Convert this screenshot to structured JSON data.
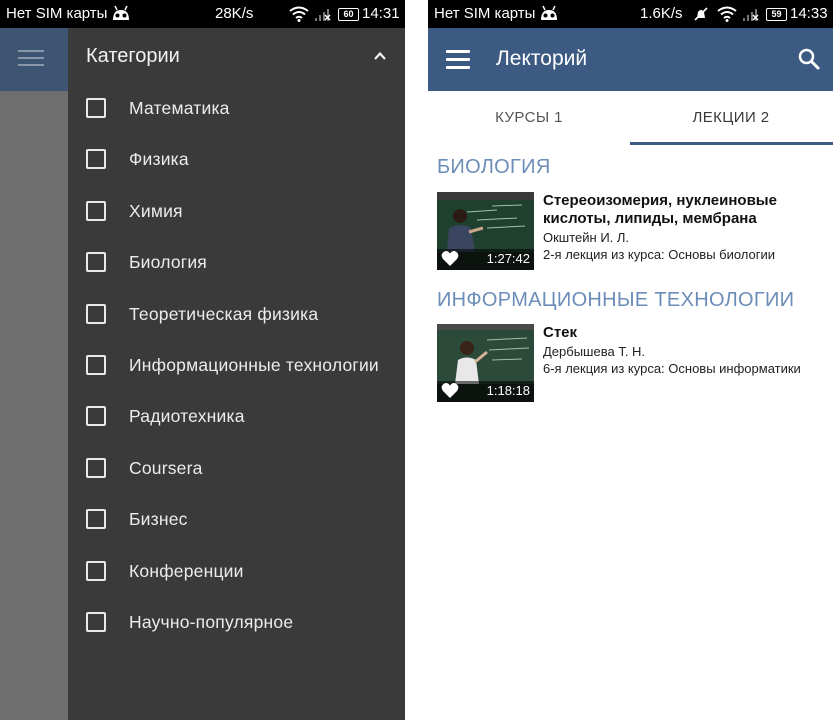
{
  "left": {
    "status": {
      "carrier": "Нет SIM карты",
      "speed": "28K/s",
      "battery": "60",
      "time": "14:31"
    },
    "drawer": {
      "title": "Категории",
      "categories": [
        {
          "label": "Математика",
          "checked": false
        },
        {
          "label": "Физика",
          "checked": false
        },
        {
          "label": "Химия",
          "checked": false
        },
        {
          "label": "Биология",
          "checked": false
        },
        {
          "label": "Теоретическая физика",
          "checked": false
        },
        {
          "label": "Информационные технологии",
          "checked": false
        },
        {
          "label": "Радиотехника",
          "checked": false
        },
        {
          "label": "Coursera",
          "checked": false
        },
        {
          "label": "Бизнес",
          "checked": false
        },
        {
          "label": "Конференции",
          "checked": false
        },
        {
          "label": "Научно-популярное",
          "checked": false
        }
      ]
    }
  },
  "right": {
    "status": {
      "carrier": "Нет SIM карты",
      "speed": "1.6K/s",
      "battery": "59",
      "time": "14:33"
    },
    "toolbar": {
      "title": "Лекторий"
    },
    "tabs": [
      {
        "label": "КУРСЫ 1",
        "active": false
      },
      {
        "label": "ЛЕКЦИИ 2",
        "active": true
      }
    ],
    "sections": [
      {
        "title": "БИОЛОГИЯ",
        "lectures": [
          {
            "title": "Стереоизомерия, нуклеиновые кислоты, липиды, мембрана",
            "author": "Окштейн И. Л.",
            "course": "2-я лекция из курса: Основы биологии",
            "duration": "1:27:42"
          }
        ]
      },
      {
        "title": "ИНФОРМАЦИОННЫЕ ТЕХНОЛОГИИ",
        "lectures": [
          {
            "title": "Стек",
            "author": "Дербышева Т. Н.",
            "course": "6-я лекция из курса: Основы информатики",
            "duration": "1:18:18"
          }
        ]
      }
    ]
  },
  "colors": {
    "toolbar": "#3c5a82",
    "section_title": "#6b8db8",
    "drawer_bg": "#3a3a3a",
    "status_bar": "#000000"
  },
  "icons": {
    "status": [
      "android-icon",
      "mute-icon",
      "wifi-icon",
      "signal-icon",
      "battery-icon"
    ],
    "drawer": [
      "chevron-up-icon",
      "checkbox-icon"
    ],
    "toolbar": [
      "menu-icon",
      "search-icon"
    ],
    "thumbnail": [
      "heart-icon"
    ]
  }
}
